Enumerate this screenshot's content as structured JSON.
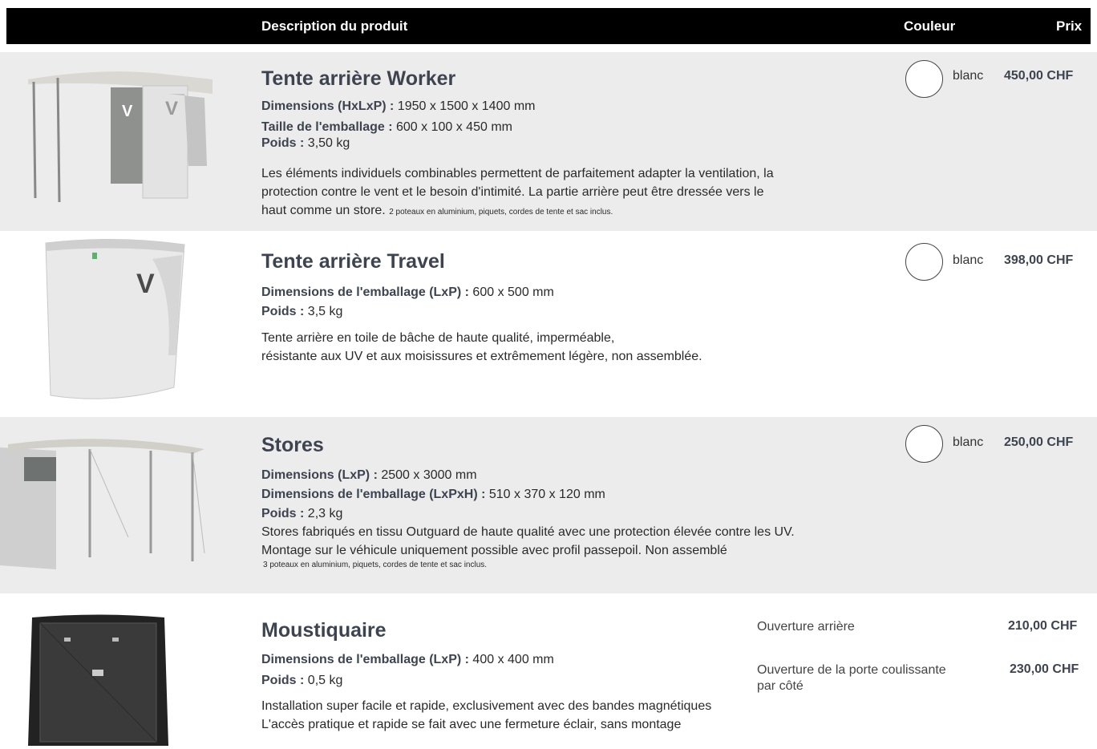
{
  "header": {
    "description": "Description du produit",
    "color": "Couleur",
    "price": "Prix"
  },
  "products": [
    {
      "title": "Tente arrière Worker",
      "specs": [
        {
          "label": "Dimensions (HxLxP) :",
          "value": " 1950 x 1500 x 1400 mm"
        },
        {
          "label": "Taille de l'emballage :",
          "value": " 600 x 100 x 450 mm"
        },
        {
          "label": "Poids :",
          "value": " 3,50 kg"
        }
      ],
      "description_lines": [
        "Les éléments individuels combinables permettent de parfaitement adapter la ventilation, la",
        "protection contre le vent et le besoin d'intimité. La partie arrière peut être dressée vers le",
        "haut comme un store."
      ],
      "note": "2 poteaux en aluminium, piquets, cordes de tente et sac inclus.",
      "color": "blanc",
      "price": "450,00 CHF"
    },
    {
      "title": "Tente arrière Travel",
      "specs": [
        {
          "label": "Dimensions de l'emballage (LxP) :",
          "value": " 600 x 500 mm"
        },
        {
          "label": "Poids :",
          "value": " 3,5 kg"
        }
      ],
      "description_lines": [
        "Tente arrière en toile de bâche de haute qualité, imperméable,",
        "résistante aux UV et aux moisissures et extrêmement légère, non assemblée."
      ],
      "color": "blanc",
      "price": "398,00 CHF"
    },
    {
      "title": "Stores",
      "specs": [
        {
          "label": "Dimensions (LxP) :",
          "value": " 2500 x 3000 mm"
        },
        {
          "label": "Dimensions de l'emballage (LxPxH) :",
          "value": " 510 x 370 x 120 mm"
        },
        {
          "label": "Poids :",
          "value": " 2,3 kg"
        }
      ],
      "description_lines": [
        "Stores fabriqués en tissu Outguard de haute qualité avec une protection élevée contre les UV.",
        "Montage sur le véhicule uniquement possible avec profil passepoil. Non assemblé"
      ],
      "note": "3 poteaux en aluminium, piquets, cordes de tente et sac inclus.",
      "color": "blanc",
      "price": "250,00 CHF"
    },
    {
      "title": "Moustiquaire",
      "specs": [
        {
          "label": "Dimensions de l'emballage (LxP) :",
          "value": " 400 x 400 mm"
        },
        {
          "label": "Poids :",
          "value": " 0,5 kg"
        }
      ],
      "description_lines": [
        "Installation super facile et rapide, exclusivement avec des bandes magnétiques",
        "L'accès pratique et rapide se fait avec une fermeture éclair, sans montage"
      ],
      "options": [
        {
          "line1": "Ouverture arrière",
          "line2": "",
          "price": "210,00 CHF"
        },
        {
          "line1": "Ouverture de la porte coulissante",
          "line2": "par côté",
          "price": "230,00 CHF"
        }
      ]
    }
  ]
}
